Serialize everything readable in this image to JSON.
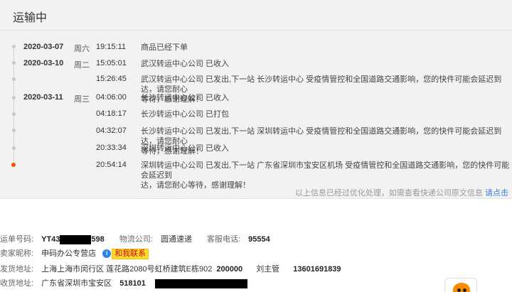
{
  "section_title": "运输中",
  "timeline": [
    {
      "date": "2020-03-07",
      "weekday": "周六",
      "time": "19:15:11",
      "lines": [
        "商品已经下单"
      ]
    },
    {
      "date": "2020-03-10",
      "weekday": "周二",
      "time": "15:05:01",
      "lines": [
        "武汉转运中心公司 已收入"
      ]
    },
    {
      "date": "",
      "weekday": "",
      "time": "15:26:45",
      "lines": [
        "武汉转运中心公司 已发出,下一站 长沙转运中心 受疫情管控和全国道路交通影响，您的快件可能会延迟到达，请您耐心",
        "等待，感谢理解！"
      ]
    },
    {
      "date": "2020-03-11",
      "weekday": "周三",
      "time": "04:06:00",
      "lines": [
        "长沙转运中心公司 已收入"
      ]
    },
    {
      "date": "",
      "weekday": "",
      "time": "04:18:17",
      "lines": [
        "长沙转运中心公司 已打包"
      ]
    },
    {
      "date": "",
      "weekday": "",
      "time": "04:32:07",
      "lines": [
        "长沙转运中心公司 已发出,下一站 深圳转运中心 受疫情管控和全国道路交通影响，您的快件可能会延迟到达，请您耐心",
        "等待，感谢理解！"
      ]
    },
    {
      "date": "",
      "weekday": "",
      "time": "20:33:34",
      "lines": [
        "深圳转运中心公司 已收入"
      ]
    },
    {
      "date": "",
      "weekday": "",
      "time": "20:54:14",
      "lines": [
        "深圳转运中心公司 已发出,下一站 广东省深圳市宝安区机场 受疫情管控和全国道路交通影响，您的快件可能会延迟到",
        "达，请您耐心等待，感谢理解！"
      ]
    }
  ],
  "footer_note": "以上信息已经过优化处理，如需查看快递公司原文信息",
  "footer_link": "请点击",
  "shipment": {
    "tracking_label": "运单号码:",
    "tracking_prefix": "YT43",
    "tracking_suffix": "598",
    "carrier_label": "物流公司:",
    "carrier": "圆通速递",
    "phone_label": "客服电话:",
    "phone": "95554",
    "seller_label": "卖家昵称:",
    "seller": "申码办公专营店",
    "contact_badge_icon": "i",
    "contact_badge": "和我联系",
    "ship_from_label": "发货地址:",
    "ship_from": "上海上海市闵行区 莲花路2080号虹桥建筑E栋902",
    "ship_from_zip": "200000",
    "ship_from_name": "刘主管",
    "ship_from_phone": "13601691839",
    "ship_to_label": "收货地址:",
    "ship_to": "广东省深圳市宝安区",
    "ship_to_zip": "518101"
  },
  "colors": {
    "panel_bg": "#f2f2f2",
    "active_dot": "#ff4d00",
    "link": "#3a7fd9",
    "badge_bg": "#ffde2a",
    "badge_text": "#d4001a",
    "mascot": "#ff8a00"
  }
}
